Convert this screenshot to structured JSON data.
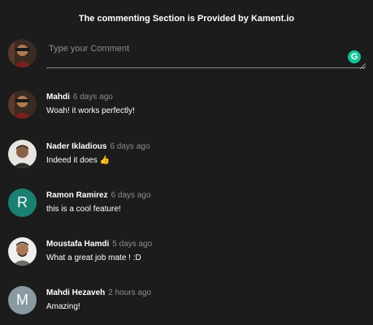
{
  "header": {
    "title": "The commenting Section is Provided by Kament.io"
  },
  "compose": {
    "placeholder": "Type your Comment",
    "grammarly_icon": "grammarly-icon",
    "grammarly_glyph": "G"
  },
  "colors": {
    "background": "#1c1c1c",
    "ramon_avatar": "#1b8071",
    "mahdi_h_avatar": "#8a9aa3",
    "grammarly": "#15c39a"
  },
  "comments": [
    {
      "author": "Mahdi",
      "time": "6 days ago",
      "text": "Woah! it works perfectly!",
      "avatar": "photo"
    },
    {
      "author": "Nader Ikladious",
      "time": "6 days ago",
      "text": "Indeed it does",
      "emoji": "👍",
      "avatar": "photo"
    },
    {
      "author": "Ramon Ramirez",
      "time": "6 days ago",
      "text": "this is a cool feature!",
      "avatar_letter": "R"
    },
    {
      "author": "Moustafa Hamdi",
      "time": "5 days ago",
      "text": "What a great job mate ! :D",
      "avatar": "photo"
    },
    {
      "author": "Mahdi Hezaveh",
      "time": "2 hours ago",
      "text": "Amazing!",
      "avatar_letter": "M"
    }
  ]
}
